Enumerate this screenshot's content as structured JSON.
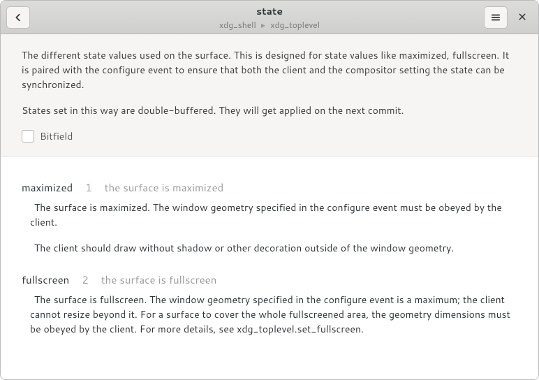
{
  "header": {
    "title": "state",
    "breadcrumb_parent": "xdg_shell",
    "breadcrumb_child": "xdg_toplevel"
  },
  "intro": {
    "p1": "The different state values used on the surface. This is designed for state values like maximized, fullscreen. It is paired with the configure event to ensure that both the client and the compositor setting the state can be synchronized.",
    "p2": "States set in this way are double-buffered. They will get applied on the next commit.",
    "bitfield_label": "Bitfield"
  },
  "entries": [
    {
      "name": "maximized",
      "value": "1",
      "summary": "the surface is maximized",
      "body": [
        "The surface is maximized. The window geometry specified in the configure   event must be obeyed by the client.",
        "The client should draw without shadow or other   decoration outside of the window geometry."
      ]
    },
    {
      "name": "fullscreen",
      "value": "2",
      "summary": "the surface is fullscreen",
      "body": [
        "The surface is fullscreen. The window geometry specified in the   configure event is a maximum; the client cannot resize beyond it. For   a surface to cover the whole fullscreened area, the geometry   dimensions must be obeyed by the client. For more details, see   xdg_toplevel.set_fullscreen."
      ]
    }
  ]
}
